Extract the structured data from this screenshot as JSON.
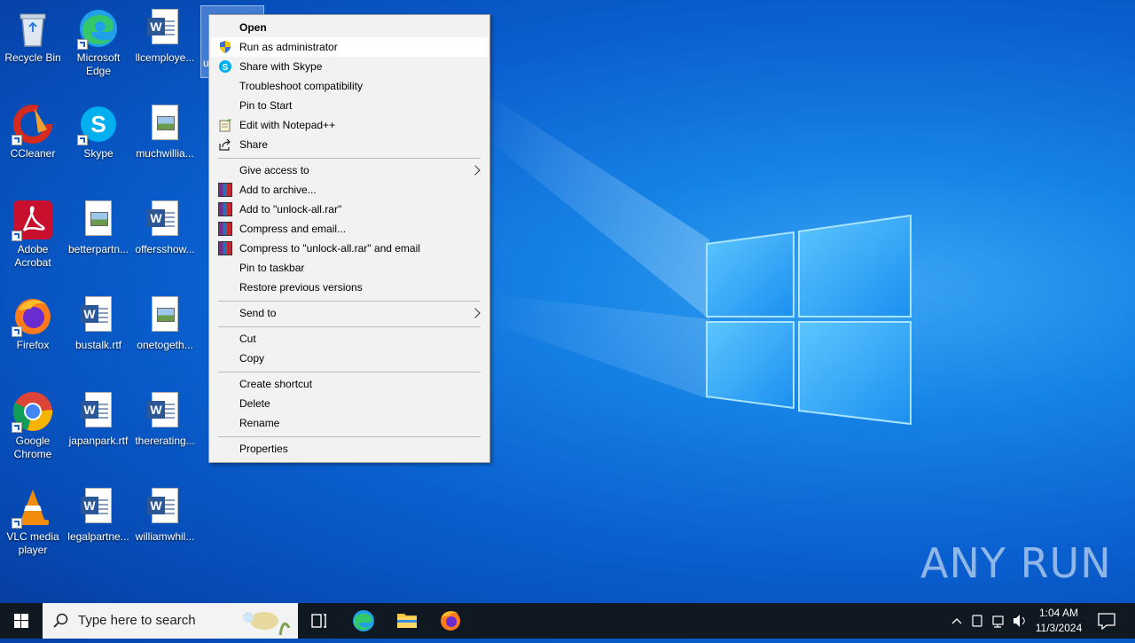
{
  "desktop": {
    "icons": [
      {
        "label": "Recycle Bin"
      },
      {
        "label": "Microsoft Edge"
      },
      {
        "label": "llcemploye..."
      },
      {
        "label": "u"
      },
      {
        "label": "CCleaner"
      },
      {
        "label": "Skype"
      },
      {
        "label": "muchwillia..."
      },
      {
        "label": "Adobe Acrobat"
      },
      {
        "label": "betterpartn..."
      },
      {
        "label": "offersshow..."
      },
      {
        "label": "Firefox"
      },
      {
        "label": "bustalk.rtf"
      },
      {
        "label": "onetogeth..."
      },
      {
        "label": "Google Chrome"
      },
      {
        "label": "japanpark.rtf"
      },
      {
        "label": "thererating..."
      },
      {
        "label": "VLC media player"
      },
      {
        "label": "legalpartne..."
      },
      {
        "label": "williamwhil..."
      }
    ]
  },
  "context_menu": {
    "items": [
      {
        "label": "Open"
      },
      {
        "label": "Run as administrator"
      },
      {
        "label": "Share with Skype"
      },
      {
        "label": "Troubleshoot compatibility"
      },
      {
        "label": "Pin to Start"
      },
      {
        "label": "Edit with Notepad++"
      },
      {
        "label": "Share"
      },
      {
        "label": "Give access to"
      },
      {
        "label": "Add to archive..."
      },
      {
        "label": "Add to \"unlock-all.rar\""
      },
      {
        "label": "Compress and email..."
      },
      {
        "label": "Compress to \"unlock-all.rar\" and email"
      },
      {
        "label": "Pin to taskbar"
      },
      {
        "label": "Restore previous versions"
      },
      {
        "label": "Send to"
      },
      {
        "label": "Cut"
      },
      {
        "label": "Copy"
      },
      {
        "label": "Create shortcut"
      },
      {
        "label": "Delete"
      },
      {
        "label": "Rename"
      },
      {
        "label": "Properties"
      }
    ]
  },
  "taskbar": {
    "search_placeholder": "Type here to search",
    "time": "1:04 AM",
    "date": "11/3/2024"
  },
  "watermark": "ANY RUN"
}
